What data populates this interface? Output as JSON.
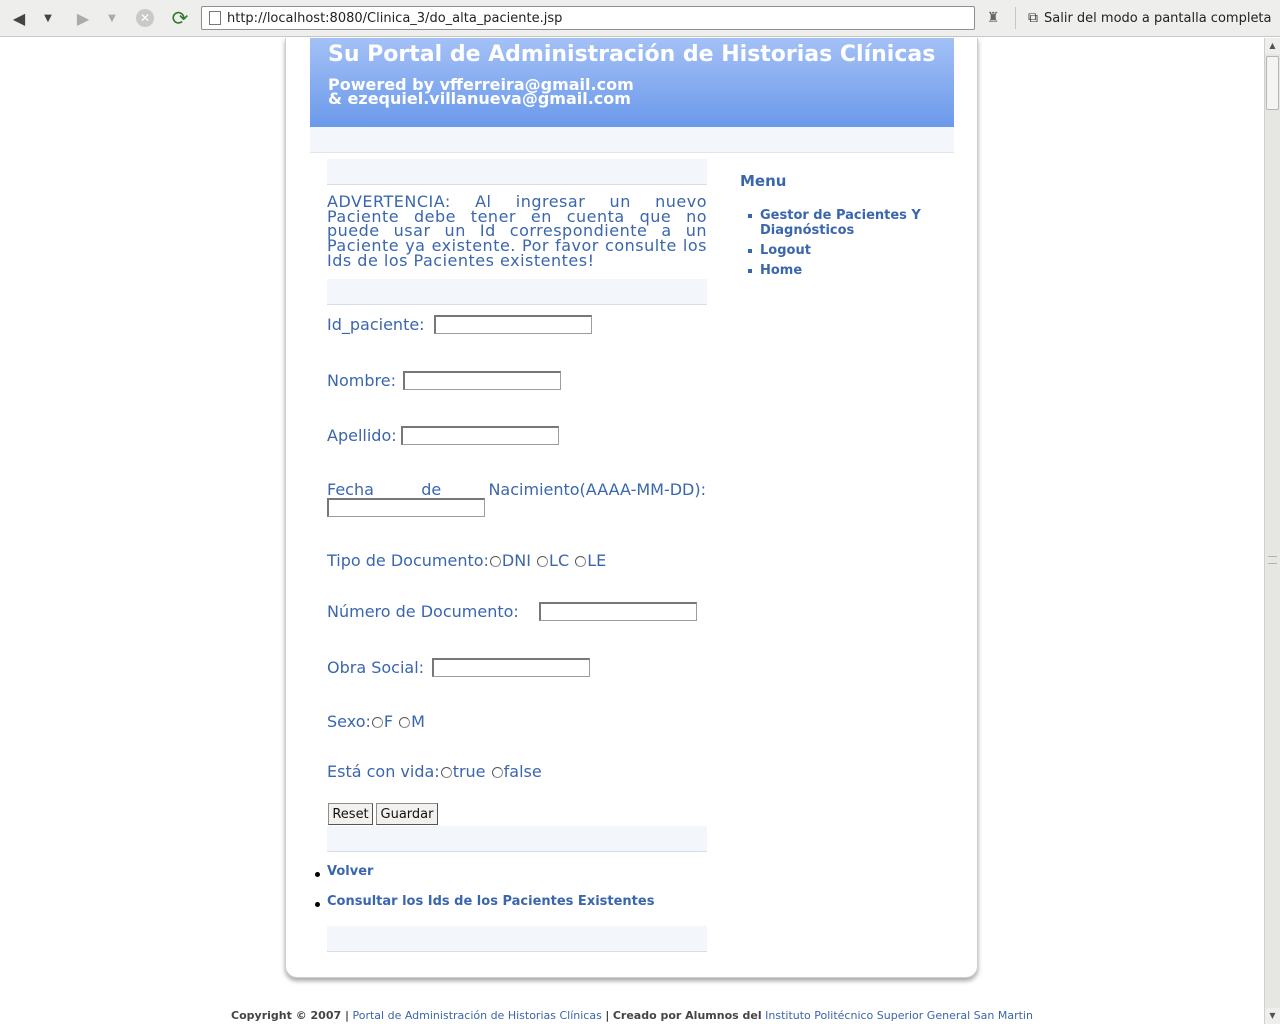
{
  "browser": {
    "url": "http://localhost:8080/Clinica_3/do_alta_paciente.jsp",
    "exit_fullscreen_label": "Salir del modo a pantalla completa"
  },
  "header": {
    "title": "Su Portal de Administración de Historias Clínicas",
    "powered_line1": "Powered by vfferreira@gmail.com",
    "powered_line2": "& ezequiel.villanueva@gmail.com"
  },
  "warning": "ADVERTENCIA: Al ingresar un nuevo Paciente debe tener en cuenta que no puede usar un Id correspondiente a un Paciente ya existente. Por favor consulte los Ids de los Pacientes existentes!",
  "form": {
    "id_label": "Id_paciente:",
    "id_value": "",
    "nombre_label": "Nombre:",
    "nombre_value": "",
    "apellido_label": "Apellido:",
    "apellido_value": "",
    "fecha_label": "Fecha de Nacimiento(AAAA-MM-DD):",
    "fecha_value": "",
    "tipo_doc_label": "Tipo de Documento:",
    "tipo_doc_options": [
      "DNI",
      "LC",
      "LE"
    ],
    "num_doc_label": "Número de Documento:",
    "num_doc_value": "",
    "obra_social_label": "Obra Social:",
    "obra_social_value": "",
    "sexo_label": "Sexo:",
    "sexo_options": [
      "F",
      "M"
    ],
    "vida_label": "Está con vida:",
    "vida_options": [
      "true",
      "false"
    ],
    "reset_label": "Reset",
    "guardar_label": "Guardar"
  },
  "links": {
    "volver": "Volver",
    "consultar": "Consultar los Ids de los Pacientes Existentes"
  },
  "menu": {
    "title": "Menu",
    "items": [
      "Gestor de Pacientes Y Diagnósticos",
      "Logout",
      "Home"
    ]
  },
  "footer": {
    "copyright": "Copyright © 2007 |",
    "portal_link": "Portal de Administración de Historias Clínicas",
    "sep": "|",
    "created_by": "Creado por Alumnos del",
    "institute_link": "Instituto Politécnico Superior General San Martin"
  }
}
